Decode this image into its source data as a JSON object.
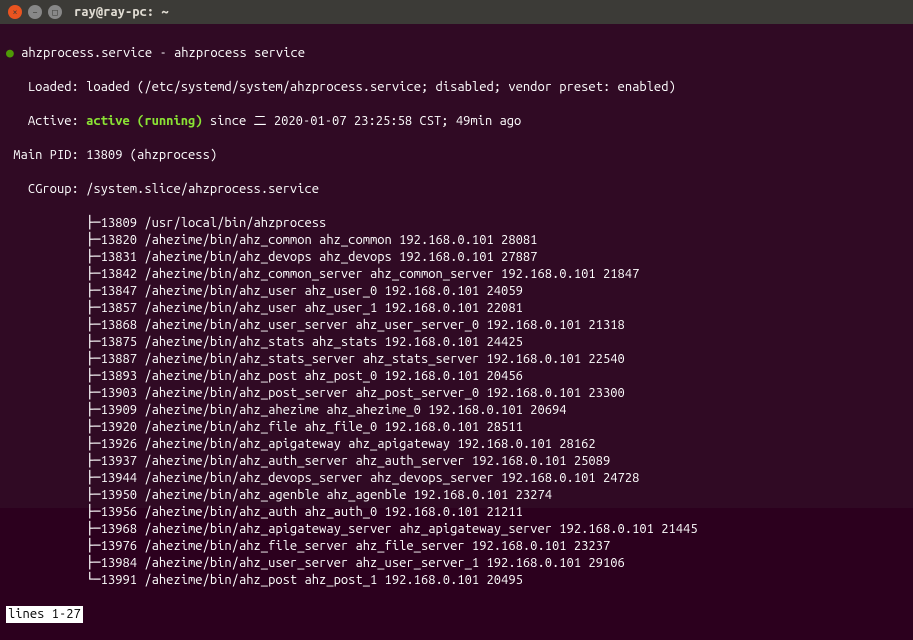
{
  "window": {
    "title": "ray@ray-pc: ~",
    "close_label": "×",
    "min_label": "−",
    "max_label": "□"
  },
  "service": {
    "bullet": "●",
    "name": "ahzprocess.service",
    "sep": "-",
    "desc": "ahzprocess service"
  },
  "loaded": {
    "label": "   Loaded: ",
    "value": "loaded (/etc/systemd/system/ahzprocess.service; disabled; vendor preset: enabled)"
  },
  "active": {
    "label": "   Active: ",
    "status": "active (running)",
    "since": " since 二 2020-01-07 23:25:58 CST; 49min ago"
  },
  "pid": {
    "label": " Main PID: ",
    "value": "13809 (ahzprocess)"
  },
  "cgroup": {
    "label": "   CGroup: ",
    "path": "/system.slice/ahzprocess.service"
  },
  "tree": [
    "           ├─13809 /usr/local/bin/ahzprocess",
    "           ├─13820 /ahezime/bin/ahz_common ahz_common 192.168.0.101 28081",
    "           ├─13831 /ahezime/bin/ahz_devops ahz_devops 192.168.0.101 27887",
    "           ├─13842 /ahezime/bin/ahz_common_server ahz_common_server 192.168.0.101 21847",
    "           ├─13847 /ahezime/bin/ahz_user ahz_user_0 192.168.0.101 24059",
    "           ├─13857 /ahezime/bin/ahz_user ahz_user_1 192.168.0.101 22081",
    "           ├─13868 /ahezime/bin/ahz_user_server ahz_user_server_0 192.168.0.101 21318",
    "           ├─13875 /ahezime/bin/ahz_stats ahz_stats 192.168.0.101 24425",
    "           ├─13887 /ahezime/bin/ahz_stats_server ahz_stats_server 192.168.0.101 22540",
    "           ├─13893 /ahezime/bin/ahz_post ahz_post_0 192.168.0.101 20456",
    "           ├─13903 /ahezime/bin/ahz_post_server ahz_post_server_0 192.168.0.101 23300",
    "           ├─13909 /ahezime/bin/ahz_ahezime ahz_ahezime_0 192.168.0.101 20694",
    "           ├─13920 /ahezime/bin/ahz_file ahz_file_0 192.168.0.101 28511",
    "           ├─13926 /ahezime/bin/ahz_apigateway ahz_apigateway 192.168.0.101 28162",
    "           ├─13937 /ahezime/bin/ahz_auth_server ahz_auth_server 192.168.0.101 25089",
    "           ├─13944 /ahezime/bin/ahz_devops_server ahz_devops_server 192.168.0.101 24728",
    "           ├─13950 /ahezime/bin/ahz_agenble ahz_agenble 192.168.0.101 23274",
    "           ├─13956 /ahezime/bin/ahz_auth ahz_auth_0 192.168.0.101 21211",
    "           ├─13968 /ahezime/bin/ahz_apigateway_server ahz_apigateway_server 192.168.0.101 21445",
    "           ├─13976 /ahezime/bin/ahz_file_server ahz_file_server 192.168.0.101 23237",
    "           ├─13984 /ahezime/bin/ahz_user_server ahz_user_server_1 192.168.0.101 29106",
    "           └─13991 /ahezime/bin/ahz_post ahz_post_1 192.168.0.101 20495"
  ],
  "status": "lines 1-27"
}
